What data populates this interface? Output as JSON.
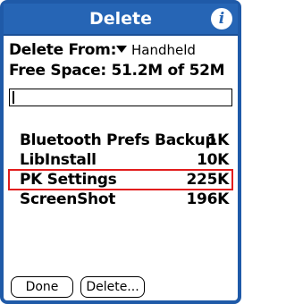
{
  "window": {
    "title": "Delete",
    "info_icon": "info-icon"
  },
  "delete_from": {
    "label": "Delete From:",
    "selected": "Handheld"
  },
  "free_space": "Free Space: 51.2M of 52M",
  "name_field": {
    "value": ""
  },
  "items": [
    {
      "name": "Bluetooth Prefs Backup",
      "size": "1K",
      "selected": false
    },
    {
      "name": "LibInstall",
      "size": "10K",
      "selected": false
    },
    {
      "name": "PK Settings",
      "size": "225K",
      "selected": true
    },
    {
      "name": "ScreenShot",
      "size": "196K",
      "selected": false
    }
  ],
  "buttons": {
    "done": "Done",
    "delete": "Delete..."
  },
  "colors": {
    "titlebar": "#2665b5",
    "selection_outline": "#e21d1d"
  }
}
